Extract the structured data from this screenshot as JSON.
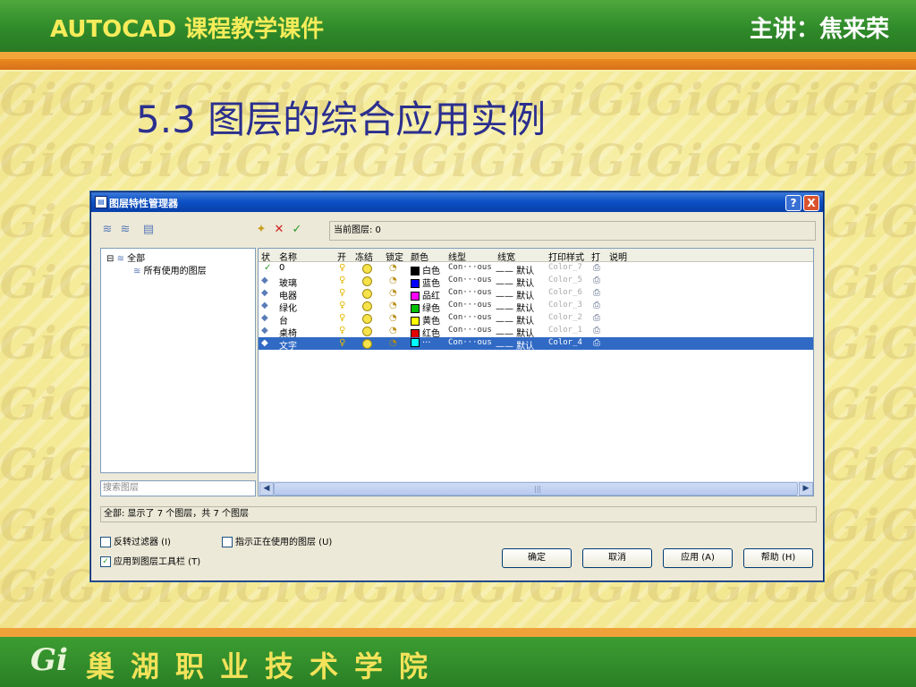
{
  "header": {
    "title": "AUTOCAD 课程教学课件",
    "presenter": "主讲：焦来荣"
  },
  "slide": {
    "title": "5.3  图层的综合应用实例"
  },
  "footer": {
    "logo": "Gi",
    "institution": "巢湖职业技术学院"
  },
  "background": {
    "pattern_text": "GiGiGiGiGiGiGiGiGiGiGiGiGiGiGiGi"
  },
  "dialog": {
    "title": "图层特性管理器",
    "current_layer_label": "当前图层: 0",
    "tree": {
      "root": "全部",
      "child": "所有使用的图层"
    },
    "search_placeholder": "搜索图层",
    "columns": [
      "状",
      "名称",
      "开",
      "冻结",
      "锁定",
      "颜色",
      "线型",
      "线宽",
      "打印样式",
      "打",
      "说明"
    ],
    "layers": [
      {
        "status": "✓",
        "name": "0",
        "color_name": "白色",
        "color_hex": "#000000",
        "linetype": "Con···ous",
        "lineweight": "—— 默认",
        "plot_style": "Color_7",
        "selected": false
      },
      {
        "status": "",
        "name": "玻璃",
        "color_name": "蓝色",
        "color_hex": "#0000ff",
        "linetype": "Con···ous",
        "lineweight": "—— 默认",
        "plot_style": "Color_5",
        "selected": false
      },
      {
        "status": "",
        "name": "电器",
        "color_name": "品红",
        "color_hex": "#ff00ff",
        "linetype": "Con···ous",
        "lineweight": "—— 默认",
        "plot_style": "Color_6",
        "selected": false
      },
      {
        "status": "",
        "name": "绿化",
        "color_name": "绿色",
        "color_hex": "#00c000",
        "linetype": "Con···ous",
        "lineweight": "—— 默认",
        "plot_style": "Color_3",
        "selected": false
      },
      {
        "status": "",
        "name": "台",
        "color_name": "黄色",
        "color_hex": "#ffff00",
        "linetype": "Con···ous",
        "lineweight": "—— 默认",
        "plot_style": "Color_2",
        "selected": false
      },
      {
        "status": "",
        "name": "桌椅",
        "color_name": "红色",
        "color_hex": "#e00000",
        "linetype": "Con···ous",
        "lineweight": "—— 默认",
        "plot_style": "Color_1",
        "selected": false
      },
      {
        "status": "",
        "name": "文字",
        "color_name": "···",
        "color_hex": "#00ffff",
        "linetype": "Con···ous",
        "lineweight": "—— 默认",
        "plot_style": "Color_4",
        "selected": true
      }
    ],
    "status_text": "全部: 显示了 7 个图层，共 7 个图层",
    "invert_filter_label": "反转过滤器 (I)",
    "show_used_label": "指示正在使用的图层 (U)",
    "apply_toolbar_label": "应用到图层工具栏 (T)",
    "buttons": {
      "ok": "确定",
      "cancel": "取消",
      "apply": "应用 (A)",
      "help": "帮助 (H)"
    },
    "help_glyph": "?",
    "close_glyph": "X"
  }
}
